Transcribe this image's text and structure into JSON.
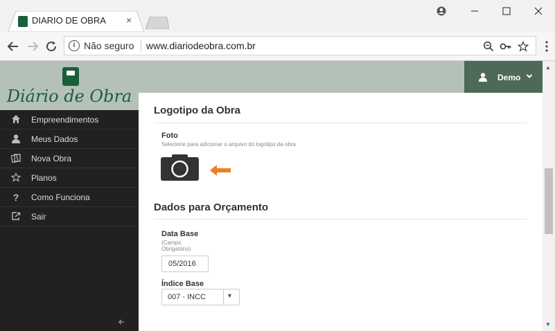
{
  "browser": {
    "tab_title": "DIARIO DE OBRA",
    "tab_close": "×",
    "security_label": "Não seguro",
    "url": "www.diariodeobra.com.br"
  },
  "sidebar": {
    "logo_text": "Diário de Obra",
    "items": [
      {
        "label": "Empreendimentos",
        "icon": "home-icon"
      },
      {
        "label": "Meus Dados",
        "icon": "user-icon"
      },
      {
        "label": "Nova Obra",
        "icon": "documents-icon"
      },
      {
        "label": "Planos",
        "icon": "star-icon"
      },
      {
        "label": "Como Funciona",
        "icon": "question-icon"
      },
      {
        "label": "Sair",
        "icon": "logout-icon"
      }
    ]
  },
  "header": {
    "user_name": "Demo"
  },
  "logo_section": {
    "title": "Logotipo da Obra",
    "field_label": "Foto",
    "field_hint": "Selecione para adicionar o arquivo do logotipo da obra"
  },
  "budget_section": {
    "title": "Dados para Orçamento",
    "base_date_label": "Data Base",
    "base_date_hint_1": "(Campo",
    "base_date_hint_2": "Obrigatório)",
    "base_date_value": "05/2016",
    "index_label": "Índice Base",
    "index_value": "007 - INCC"
  },
  "colors": {
    "brand_green": "#1b5e3a",
    "sidebar_bg": "#212121",
    "header_bg": "#b4c1b9",
    "user_box_bg": "#4e6a57",
    "arrow_orange": "#f07f22"
  }
}
